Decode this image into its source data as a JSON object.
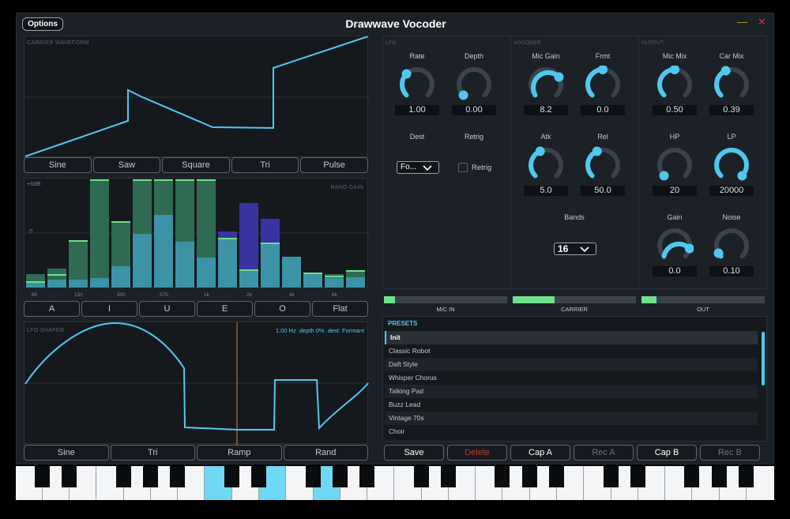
{
  "window": {
    "title": "Drawwave Vocoder",
    "options_label": "Options",
    "minimize_glyph": "—",
    "close_glyph": "✕"
  },
  "carrier": {
    "label": "CARRIER WAVEFORM",
    "buttons": [
      "Sine",
      "Saw",
      "Square",
      "Tri",
      "Pulse"
    ]
  },
  "band_gain": {
    "label": "BAND GAIN",
    "y_labels": [
      "+6dB",
      "0"
    ],
    "freq_labels": [
      "80",
      "150",
      "300",
      "570",
      "1k",
      "2k",
      "4k",
      "8k"
    ],
    "buttons": [
      "A",
      "I",
      "U",
      "E",
      "O",
      "Flat"
    ]
  },
  "lfo_shaper": {
    "label": "LFO SHAPER",
    "readout": "1.00 Hz  depth 0%  dest: Formant",
    "buttons": [
      "Sine",
      "Tri",
      "Ramp",
      "Rand"
    ]
  },
  "lfo": {
    "label": "LFO",
    "rate": {
      "label": "Rate",
      "value": "1.00"
    },
    "depth": {
      "label": "Depth",
      "value": "0.00"
    },
    "dest": {
      "label": "Dest",
      "value": "Fo..."
    },
    "retrig": {
      "label": "Retrig",
      "checkbox_label": "Retrig"
    }
  },
  "vocoder": {
    "label": "VOCODER",
    "mic_gain": {
      "label": "Mic Gain",
      "value": "8.2"
    },
    "frmt": {
      "label": "Frmt",
      "value": "0.0"
    },
    "atk": {
      "label": "Atk",
      "value": "5.0"
    },
    "rel": {
      "label": "Rel",
      "value": "50.0"
    },
    "bands": {
      "label": "Bands",
      "value": "16"
    }
  },
  "output": {
    "label": "OUTPUT",
    "mic_mix": {
      "label": "Mic Mix",
      "value": "0.50"
    },
    "car_mix": {
      "label": "Car Mix",
      "value": "0.39"
    },
    "hp": {
      "label": "HP",
      "value": "20"
    },
    "lp": {
      "label": "LP",
      "value": "20000"
    },
    "gain": {
      "label": "Gain",
      "value": "0.0"
    },
    "noise": {
      "label": "Noise",
      "value": "0.10"
    }
  },
  "meters": {
    "mic_in": {
      "label": "MIC IN",
      "level": 0.09
    },
    "carrier": {
      "label": "CARRIER",
      "level": 0.34
    },
    "out": {
      "label": "OUT",
      "level": 0.12
    }
  },
  "presets": {
    "header": "PRESETS",
    "items": [
      "Init",
      "Classic Robot",
      "Daft Style",
      "Whisper Chorus",
      "Talking Pad",
      "Buzz Lead",
      "Vintage 70s",
      "Choir"
    ],
    "selected": "Init"
  },
  "preset_buttons": {
    "save": "Save",
    "delete": "Delete",
    "cap_a": "Cap A",
    "rec_a": "Rec A",
    "cap_b": "Cap B",
    "rec_b": "Rec B"
  },
  "colors": {
    "accent": "#4fc8f0",
    "meter": "#6ee08b",
    "delete": "#c0392b"
  }
}
